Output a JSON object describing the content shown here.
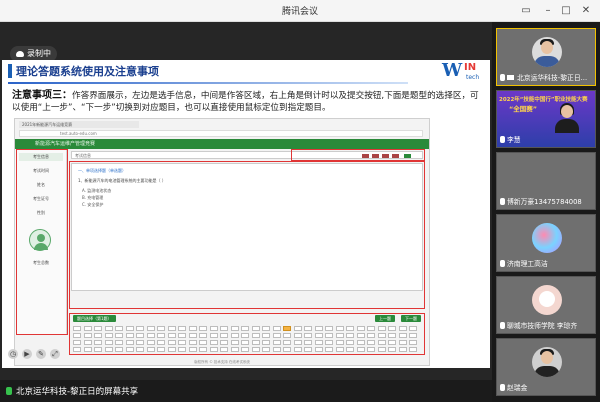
{
  "window": {
    "title": "腾讯会议"
  },
  "recording": {
    "label": "录制中"
  },
  "slide": {
    "heading": "理论答题系统使用及注意事项",
    "logo": {
      "big": "W",
      "small": "IN",
      "sub": "tech"
    },
    "note_label": "注意事项三：",
    "note_text": "作答界面展示，左边是选手信息，中间是作答区域，右上角是倒计时以及提交按钮,下面是题型的选择区，可以使用“上一步”、“下一步”切换到对应题目，也可以直接使用鼠标定位到指定题目。",
    "browser": {
      "tab": "2021年新能源汽车运维竞赛",
      "url": "test.auto-edu.com",
      "header": "新能源汽车运维产管理竞赛",
      "side_items": [
        "考生信息",
        "考试时间",
        "姓名",
        "考生证号",
        "性别",
        "考生总数"
      ],
      "info_bar": "考试信息",
      "question_title": "一、单项选择题（单选题）",
      "question_text": "1、新能源汽车的电池管理系统的主要功能是（ ）",
      "options": [
        "A. 监测电池状态",
        "B. 充电管理",
        "C. 安全保护"
      ],
      "prev_btn": "上一题",
      "next_btn": "下一题",
      "pick_btn": "题目选择（第1题）",
      "footer": "版权所有 © 技术支持 在线考试系统"
    }
  },
  "participants": [
    {
      "name": "北京运华科技-黎正日...",
      "active": true
    },
    {
      "name": "李慧",
      "active": false,
      "banner_l1": "2022年“技能中国行”职业技能大赛",
      "banner_l2": "“全国赛”"
    },
    {
      "name": "博新万豪13475784008",
      "active": false
    },
    {
      "name": "济南理工高洁",
      "active": false
    },
    {
      "name": "聊城市技师学院 李琼齐",
      "active": false
    },
    {
      "name": "赵瑞金",
      "active": false
    }
  ],
  "status_bar": {
    "share_label": "北京运华科技-黎正日的屏幕共享"
  },
  "colors": {
    "accent": "#1a5fb4",
    "header_green": "#2a8a3a",
    "highlight": "#e03535",
    "active_border": "#f2c200"
  }
}
